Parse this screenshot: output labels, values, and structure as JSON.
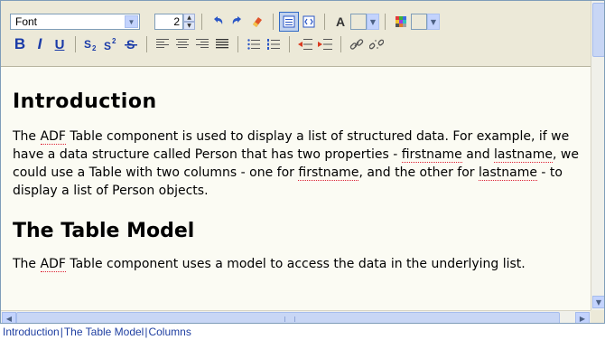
{
  "toolbar": {
    "font_select": {
      "value": "Font"
    },
    "size_spinner": {
      "value": "2"
    },
    "icons": [
      "undo-icon",
      "redo-icon",
      "eraser-icon",
      "design-view-icon",
      "source-view-icon",
      "font-color-icon",
      "highlight-color-icon",
      "bold-icon",
      "italic-icon",
      "underline-icon",
      "subscript-icon",
      "superscript-icon",
      "strikethrough-icon",
      "align-left-icon",
      "align-center-icon",
      "align-right-icon",
      "justify-icon",
      "unordered-list-icon",
      "ordered-list-icon",
      "outdent-icon",
      "indent-icon",
      "link-icon",
      "unlink-icon"
    ],
    "format": {
      "bold": "B",
      "italic": "I",
      "underline": "U",
      "font_color": "A"
    }
  },
  "content": {
    "heading1": "Introduction",
    "para1": {
      "p1": "The ",
      "adf": "ADF",
      "p2": " Table component is used to display a list of structured data. For example, if we have a data structure called Person that has two properties - ",
      "firstname": "firstname",
      "p3": " and ",
      "lastname": "lastname",
      "p4": ", we could use a Table with two columns - one for ",
      "firstname2": "firstname",
      "p5": ", and the other for ",
      "lastname2": "lastname",
      "p6": " - to display a list of Person objects."
    },
    "heading2": "The Table Model",
    "para2": {
      "p1": "The ",
      "adf": "ADF",
      "p2": " Table component uses a model to access the data in the underlying list."
    }
  },
  "breadcrumb": {
    "items": [
      "Introduction",
      "The Table Model",
      "Columns"
    ],
    "separator": "|"
  },
  "colors": {
    "toolbar_bg": "#ece9d8",
    "editor_bg": "#fbfbf3",
    "link": "#1f3fa1",
    "accent": "#316ac5"
  }
}
